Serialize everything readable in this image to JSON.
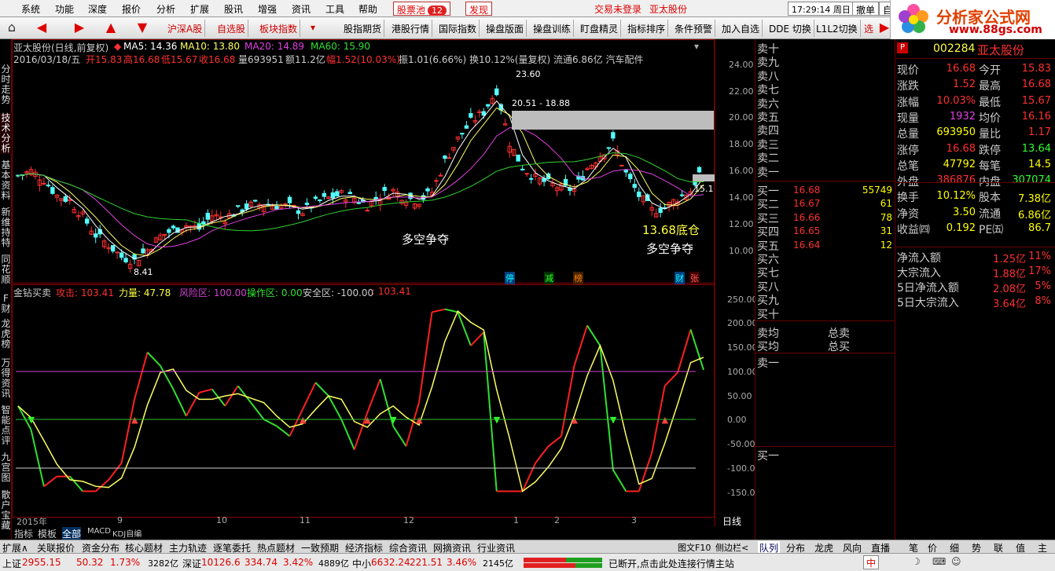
{
  "menubar": {
    "items": [
      "系统",
      "功能",
      "深度",
      "报价",
      "分析",
      "扩展",
      "股讯",
      "增强",
      "资讯",
      "工具",
      "帮助"
    ],
    "stock_pool": "股票池",
    "stock_pool_badge": "12",
    "discover": "发现",
    "trade_login": "交易未登录",
    "stock_name": "亚太股份",
    "clock": "17:29:14 周日",
    "withdraw": "撤单",
    "self": "自选"
  },
  "toolbar": {
    "items": [
      "沪深A股",
      "自选股",
      "板块指数",
      "股指期货",
      "港股行情",
      "国际指数",
      "操盘版面",
      "操盘训练",
      "盯盘精灵",
      "指标排序",
      "条件预警",
      "加入自选",
      "DDE 切换",
      "L1L2切换",
      "选"
    ]
  },
  "logo": {
    "title": "分析家公式网",
    "url": "www.88gs.com"
  },
  "lefttabs": [
    "分时走势",
    "技术分析",
    "基本资料",
    "新维持特",
    "同花顺",
    "F财",
    "龙虎榜",
    "万得资讯",
    "智能点评",
    "九宫图",
    "散户宝藏"
  ],
  "chart": {
    "title": "亚太股份(日线,前复权)",
    "ma5": "MA5: 14.36",
    "ma10": "MA10: 13.80",
    "ma20": "MA20: 14.89",
    "ma60": "MA60: 15.90",
    "info_date": "2016/03/18/五",
    "info_open": "开15.83",
    "info_high": "高16.68",
    "info_low": "低15.67",
    "info_close": "收16.68",
    "info_vol": "量693951",
    "info_amt": "额11.2亿",
    "info_amp": "幅1.52(10.03%)",
    "info_rest": "振1.01(6.66%) 换10.12%(量复权) 流通6.86亿 汽车配件",
    "price_ticks": [
      "24.00",
      "22.00",
      "20.00",
      "18.00",
      "16.00",
      "14.00",
      "12.00",
      "10.00"
    ],
    "ann_high": "23.60",
    "ann_range": "20.51 - 18.88",
    "ann_low": "8.41",
    "ann_right": "15.1",
    "text_duokong1": "多空争夺",
    "text_bottom": "13.68底仓",
    "text_duokong2": "多空争夺",
    "markers": [
      "停",
      "减",
      "榜",
      "财",
      "张"
    ],
    "indicator_title": "金钻买卖",
    "ind_attack": "攻击: 103.41",
    "ind_power": "力量: 47.78",
    "ind_risk": "风险区: 100.00",
    "ind_op": "操作区: 0.00",
    "ind_safe": "安全区: -100.00",
    "ind_last": ": 103.41",
    "ind_ticks": [
      "250.00",
      "200.00",
      "150.00",
      "100.00",
      "50.00",
      "0.00",
      "-50.00",
      "-100.00",
      "-150.00"
    ],
    "x_labels": [
      "2015年",
      "9",
      "10",
      "11",
      "12",
      "1",
      "2",
      "3"
    ],
    "period": "日线"
  },
  "chart_data": {
    "type": "line",
    "title": "亚太股份(日线,前复权)",
    "ylim": [
      8,
      25
    ],
    "series": [
      {
        "name": "MA5",
        "values": [
          14.36
        ]
      },
      {
        "name": "MA10",
        "values": [
          13.8
        ]
      },
      {
        "name": "MA20",
        "values": [
          14.89
        ]
      },
      {
        "name": "MA60",
        "values": [
          15.9
        ]
      }
    ],
    "close_path": [
      15.8,
      16.2,
      15.5,
      14.2,
      13.8,
      12.5,
      11.0,
      10.2,
      9.2,
      8.9,
      9.8,
      10.9,
      11.4,
      11.8,
      11.5,
      12.6,
      12.4,
      13.0,
      13.4,
      13.5,
      13.4,
      13.3,
      12.9,
      13.6,
      14.0,
      14.3,
      14.0,
      13.4,
      14.2,
      14.6,
      14.0,
      13.8,
      14.5,
      17.0,
      18.8,
      20.2,
      21.0,
      22.8,
      18.5,
      16.5,
      15.6,
      15.2,
      14.8,
      14.7,
      16.4,
      17.5,
      18.6,
      16.0,
      14.2,
      13.0,
      13.2,
      14.0,
      14.6,
      16.68
    ],
    "indicator": {
      "risk": 100,
      "op": 0,
      "safe": -100,
      "attack": 103.41,
      "power": 47.78
    }
  },
  "queue": {
    "sell": [
      "卖十",
      "卖九",
      "卖八",
      "卖七",
      "卖六",
      "卖五",
      "卖四",
      "卖三",
      "卖二",
      "卖一"
    ],
    "buy": [
      {
        "l": "买一",
        "p": "16.68",
        "v": "55749"
      },
      {
        "l": "买二",
        "p": "16.67",
        "v": "61"
      },
      {
        "l": "买三",
        "p": "16.66",
        "v": "78"
      },
      {
        "l": "买四",
        "p": "16.65",
        "v": "31"
      },
      {
        "l": "买五",
        "p": "16.64",
        "v": "12"
      },
      {
        "l": "买六",
        "p": "",
        "v": ""
      },
      {
        "l": "买七",
        "p": "",
        "v": ""
      },
      {
        "l": "买八",
        "p": "",
        "v": ""
      },
      {
        "l": "买九",
        "p": "",
        "v": ""
      },
      {
        "l": "买十",
        "p": "",
        "v": ""
      }
    ],
    "avg_sell": "卖均",
    "avg_buy": "买均",
    "total_sell": "总卖",
    "total_buy": "总买",
    "sell1": "卖一",
    "buy1": "买一"
  },
  "quote": {
    "code": "002284",
    "name": "亚太股份",
    "rows": [
      {
        "k1": "现价",
        "v1": "16.68",
        "c1": "#ff3030",
        "k2": "今开",
        "v2": "15.83",
        "c2": "#ff3030"
      },
      {
        "k1": "涨跌",
        "v1": "1.52",
        "c1": "#ff3030",
        "k2": "最高",
        "v2": "16.68",
        "c2": "#ff3030"
      },
      {
        "k1": "涨幅",
        "v1": "10.03%",
        "c1": "#ff3030",
        "k2": "最低",
        "v2": "15.67",
        "c2": "#ff3030"
      },
      {
        "k1": "现量",
        "v1": "1932",
        "c1": "#e040e0",
        "k2": "均价",
        "v2": "16.16",
        "c2": "#ff3030"
      },
      {
        "k1": "总量",
        "v1": "693950",
        "c1": "#ffff00",
        "k2": "量比",
        "v2": "1.17",
        "c2": "#ff3030"
      },
      {
        "k1": "涨停",
        "v1": "16.68",
        "c1": "#ff3030",
        "k2": "跌停",
        "v2": "13.64",
        "c2": "#30ff30"
      },
      {
        "k1": "总笔",
        "v1": "47792",
        "c1": "#ffff00",
        "k2": "每笔",
        "v2": "14.5",
        "c2": "#ffff00"
      },
      {
        "k1": "外盘",
        "v1": "386876",
        "c1": "#ff3030",
        "k2": "内盘",
        "v2": "307074",
        "c2": "#30ff30"
      },
      {
        "k1": "换手",
        "v1": "10.12%",
        "c1": "#ffff00",
        "k2": "股本",
        "v2": "7.38亿",
        "c2": "#ffff00"
      },
      {
        "k1": "净资",
        "v1": "3.50",
        "c1": "#ffff00",
        "k2": "流通",
        "v2": "6.86亿",
        "c2": "#ffff00"
      },
      {
        "k1": "收益㈣",
        "v1": "0.192",
        "c1": "#ffff00",
        "k2": "PE㈤",
        "v2": "86.7",
        "c2": "#ffff00"
      }
    ],
    "flows": [
      {
        "k": "净流入额",
        "v": "1.25亿",
        "p": "11%"
      },
      {
        "k": "大宗流入",
        "v": "1.88亿",
        "p": "17%"
      },
      {
        "k": "5日净流入额",
        "v": "2.08亿",
        "p": "5%"
      },
      {
        "k": "5日大宗流入",
        "v": "3.64亿",
        "p": "8%"
      }
    ]
  },
  "bottom": {
    "subtabs": [
      "指标",
      "模板",
      "全部",
      "MACD",
      "KDJ自编"
    ],
    "tabs": [
      "扩展∧",
      "关联报价",
      "资金分布",
      "核心题材",
      "主力轨迹",
      "逐笔委托",
      "热点题材",
      "一致预期",
      "经济指标",
      "综合资讯",
      "网摘资讯",
      "行业资讯"
    ],
    "right_mini": "图文F10",
    "right_mini2": "侧边栏<",
    "rtabs": [
      "队列",
      "分布",
      "龙虎",
      "风向",
      "直播",
      "笔",
      "价",
      "细",
      "势",
      "联",
      "值",
      "主"
    ]
  },
  "status": {
    "sh_label": "上证",
    "sh_val": "2955.15",
    "sh_chg": "50.32",
    "sh_pct": "1.73%",
    "sh_amt": "3282亿",
    "sz_label": "深证",
    "sz_val": "10126.6",
    "sz_chg": "334.74",
    "sz_pct": "3.42%",
    "sz_amt": "4889亿",
    "zx_label": "中小",
    "zx_val": "6632.24",
    "zx_chg": "221.51",
    "zx_pct": "3.46%",
    "zx_amt": "2145亿",
    "conn": "已断开,点击此处连接行情主站"
  }
}
